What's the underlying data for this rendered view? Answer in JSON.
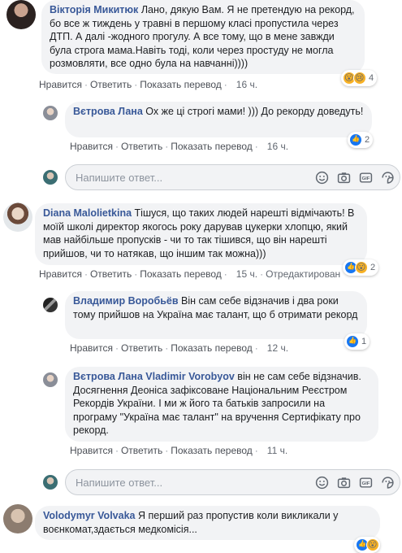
{
  "actions": {
    "like": "Нравится",
    "reply": "Ответить",
    "translate": "Показать перевод",
    "edited": "Отредактирован"
  },
  "reply_placeholder": "Напишите ответ...",
  "comments": [
    {
      "author": "Вікторія Микитюк",
      "text": "Лано, дякую Вам. Я не претендую на рекорд, бо все ж тиждень у травні в першому класі пропустила через ДТП. А далі -жодного прогулу. А все тому, що в мене завжди була строга мама.Навіть тоді, коли через простуду не могла розмовляти, все одно була на навчанні))))",
      "time": "16 ч.",
      "reactions": "4"
    },
    {
      "author": "Вєтрова Лана",
      "text": "Ох же ці строгі мами! ))) До рекорду доведуть!",
      "time": "16 ч.",
      "reactions": "2"
    },
    {
      "author": "Diana Malolietkina",
      "text": "Тішуся, що таких людей нарешті відмічають! В моїй школі директор якогось року дарував цукерки хлопцю, який мав найбільше пропусків - чи то так тішився, що він нарешті прийшов, чи то натякав, що іншим так можна)))",
      "time": "15 ч.",
      "reactions": "2"
    },
    {
      "author": "Владимир Воробьёв",
      "text": "Він сам себе відзначив і два роки тому прийшов на Україна має талант, що б отримати рекорд",
      "time": "12 ч.",
      "reactions": "1"
    },
    {
      "author": "Вєтрова Лана",
      "tag": "Vladimir Vorobyov",
      "text": "він не сам себе відзначив. Досягнення Деоніса зафіксоване Національним Реєстром Рекордів України. І ми ж його та батьків запросили на програму \"Україна має талант\" на вручення Сертифікату про рекорд.",
      "time": "11 ч."
    },
    {
      "author": "Volodymyr Volvaka",
      "text": "Я перший раз пропустив коли викликали у воєнкомат,здається медкомісія..."
    }
  ]
}
